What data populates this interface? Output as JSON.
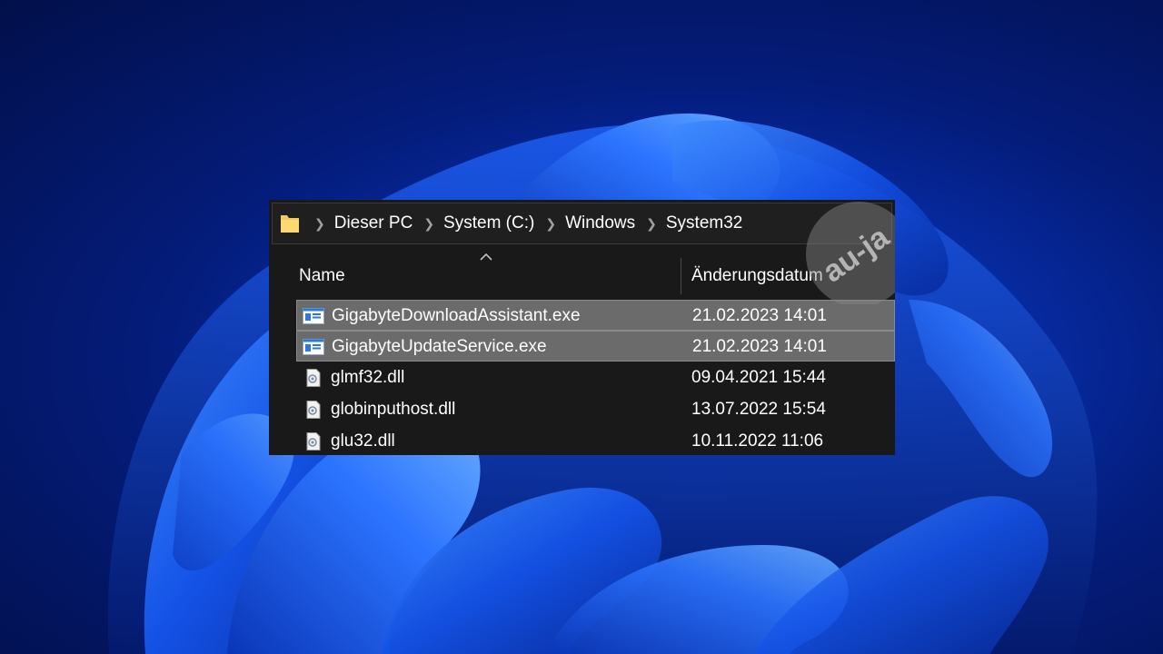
{
  "breadcrumb": {
    "icon": "folder-icon",
    "items": [
      {
        "label": "Dieser PC"
      },
      {
        "label": "System (C:)"
      },
      {
        "label": "Windows"
      },
      {
        "label": "System32"
      }
    ]
  },
  "columns": {
    "name": "Name",
    "date": "Änderungsdatum",
    "sort": "ascending"
  },
  "files": [
    {
      "name": "GigabyteDownloadAssistant.exe",
      "date": "21.02.2023 14:01",
      "type": "exe",
      "selected": true
    },
    {
      "name": "GigabyteUpdateService.exe",
      "date": "21.02.2023 14:01",
      "type": "exe",
      "selected": true
    },
    {
      "name": "glmf32.dll",
      "date": "09.04.2021 15:44",
      "type": "dll",
      "selected": false
    },
    {
      "name": "globinputhost.dll",
      "date": "13.07.2022 15:54",
      "type": "dll",
      "selected": false
    },
    {
      "name": "glu32.dll",
      "date": "10.11.2022 11:06",
      "type": "dll",
      "selected": false
    }
  ],
  "watermark": {
    "text": "au-ja",
    "kind": "logo"
  },
  "colors": {
    "window_bg": "#191919",
    "selection": "#6b6b6b",
    "folder": "#f4c95a",
    "exe_icon": "#2a7bd8"
  }
}
